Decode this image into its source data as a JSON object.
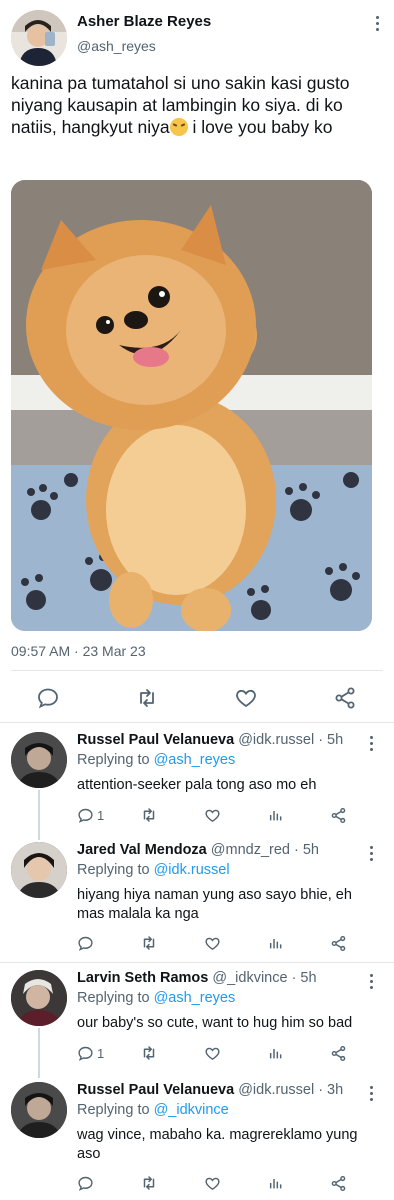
{
  "main_tweet": {
    "author_name": "Asher Blaze Reyes",
    "handle": "@ash_reyes",
    "text_line1": "kanina pa tumatahol si uno sakin kasi gusto niyang kausapin at lambingin ko siya. di ko natiis, hangkyut niya",
    "text_line2": " i love you baby ko",
    "emoji": "confounded-face",
    "timestamp": "09:57 AM · 23 Mar 23"
  },
  "replies": [
    {
      "name": "Russel Paul Velanueva",
      "handle": "@idk.russel",
      "time": "· 5h",
      "replying_prefix": "Replying to ",
      "replying_to": "@ash_reyes",
      "text": "attention-seeker pala tong aso mo eh",
      "reply_count": "1"
    },
    {
      "name": "Jared Val Mendoza",
      "handle": "@mndz_red",
      "time": "· 5h",
      "replying_prefix": "Replying to ",
      "replying_to": "@idk.russel",
      "text": "hiyang hiya naman yung aso sayo bhie, eh mas malala ka nga",
      "reply_count": ""
    },
    {
      "name": "Larvin Seth Ramos",
      "handle": "@_idkvince",
      "time": "· 5h",
      "replying_prefix": "Replying to ",
      "replying_to": "@ash_reyes",
      "text": "our baby's so cute, want to hug him so bad",
      "reply_count": "1"
    },
    {
      "name": "Russel Paul Velanueva",
      "handle": "@idk.russel",
      "time": "· 3h",
      "replying_prefix": "Replying to ",
      "replying_to": "@_idkvince",
      "text": "wag vince, mabaho ka. magrereklamo yung aso",
      "reply_count": ""
    }
  ],
  "icons": {
    "reply": "reply-icon",
    "retweet": "retweet-icon",
    "like": "heart-icon",
    "views": "views-icon",
    "share": "share-icon",
    "more": "more-icon"
  },
  "colors": {
    "link": "#1d9bf0",
    "muted": "#536471",
    "divider": "#e4e7ea"
  }
}
